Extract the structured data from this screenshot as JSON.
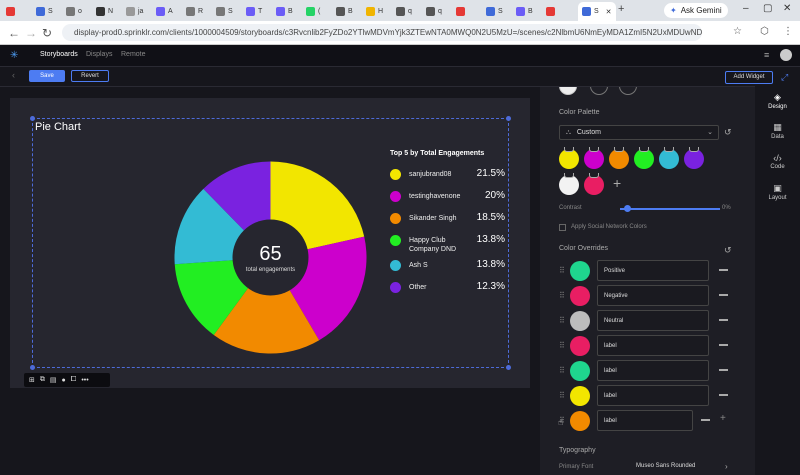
{
  "browser": {
    "tabs": [
      {
        "label": "",
        "color": "#e53935"
      },
      {
        "label": "S",
        "color": "#3f6ad8"
      },
      {
        "label": "o",
        "color": "#777777"
      },
      {
        "label": "N",
        "color": "#333333"
      },
      {
        "label": "ja",
        "color": "#999999"
      },
      {
        "label": "A",
        "color": "#6b5cf6"
      },
      {
        "label": "R",
        "color": "#777777"
      },
      {
        "label": "S",
        "color": "#777777"
      },
      {
        "label": "T",
        "color": "#6b5cf6"
      },
      {
        "label": "B",
        "color": "#6b5cf6"
      },
      {
        "label": "(",
        "color": "#25d366"
      },
      {
        "label": "B",
        "color": "#555555"
      },
      {
        "label": "H",
        "color": "#f0b400"
      },
      {
        "label": "q",
        "color": "#555555"
      },
      {
        "label": "q",
        "color": "#555555"
      },
      {
        "label": "",
        "color": "#e53935"
      },
      {
        "label": "S",
        "color": "#3f6ad8"
      },
      {
        "label": "B",
        "color": "#6b5cf6"
      },
      {
        "label": "",
        "color": "#e53935"
      }
    ],
    "active_tab": "S",
    "ask_label": "Ask Gemini",
    "url": "display-prod0.sprinklr.com/clients/1000004509/storyboards/c3Rvcnlib2FyZDo2YTlwMDVmYjk3ZTEwNTA0MWQ0N2U5MzU=/scenes/c2NlbmU6NmEyMDA1ZmI5N2UxMDUwNDFkNDdlO..."
  },
  "app_nav": {
    "tabs": [
      "Storyboards",
      "Displays",
      "Remote"
    ]
  },
  "toolbar": {
    "save": "Save",
    "revert": "Revert",
    "add_widget": "Add Widget"
  },
  "widget": {
    "title": "Pie Chart",
    "tools": [
      "⊞",
      "⧉",
      "▤",
      "●",
      "⧠",
      "•••"
    ]
  },
  "chart_data": {
    "type": "pie",
    "title": "Top 5 by Total Engagements",
    "center_value": "65",
    "center_label": "total engagements",
    "slices": [
      {
        "label": "sanjubrand08",
        "value": 21.5,
        "display": "21.5%",
        "color": "#f2e600"
      },
      {
        "label": "testinghavenone",
        "value": 20,
        "display": "20%",
        "color": "#cc00cc"
      },
      {
        "label": "Sikander Singh",
        "value": 18.5,
        "display": "18.5%",
        "color": "#f28a00"
      },
      {
        "label": "Happy Club Company DND",
        "value": 13.8,
        "display": "13.8%",
        "color": "#22ee22"
      },
      {
        "label": "Ash S",
        "value": 13.8,
        "display": "13.8%",
        "color": "#33bbd4"
      },
      {
        "label": "Other",
        "value": 12.3,
        "display": "12.3%",
        "color": "#7a22e0"
      }
    ]
  },
  "panel": {
    "color_palette_title": "Color Palette",
    "palette_select": "Custom",
    "palette_swatches": [
      "#f2e600",
      "#cc00cc",
      "#f28a00",
      "#22ee22",
      "#33bbd4",
      "#7a22e0",
      "#f2f2f2",
      "#e91e63"
    ],
    "contrast_label": "Contrast",
    "contrast_value": "0%",
    "apply_social_label": "Apply Social Network Colors",
    "overrides_title": "Color Overrides",
    "overrides": [
      {
        "label": "Positive",
        "color": "#1fd58e"
      },
      {
        "label": "Negative",
        "color": "#e91e63"
      },
      {
        "label": "Neutral",
        "color": "#bdbdbd"
      },
      {
        "label": "label",
        "color": "#e91e63"
      },
      {
        "label": "label",
        "color": "#1fd58e"
      },
      {
        "label": "label",
        "color": "#f2e600"
      },
      {
        "label": "label",
        "color": "#f28a00"
      }
    ],
    "typography_title": "Typography",
    "primary_font_label": "Primary Font",
    "primary_font_value": "Museo Sans Rounded"
  },
  "rail": {
    "items": [
      "Design",
      "Data",
      "Code",
      "Layout"
    ]
  }
}
